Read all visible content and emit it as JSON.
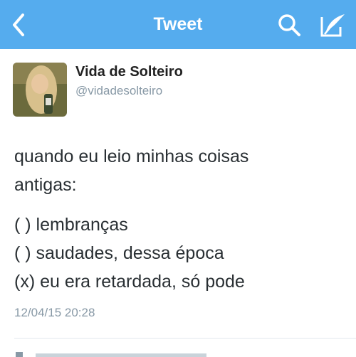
{
  "header": {
    "title": "Tweet",
    "bg_color": "#55acee",
    "back_icon": "chevron-left-icon",
    "search_icon": "search-icon",
    "compose_icon": "compose-icon"
  },
  "tweet": {
    "name": "Vida de Solteiro",
    "handle": "@vidadesolteiro",
    "text_lines": [
      "quando eu leio minhas coisas",
      "antigas:"
    ],
    "options": [
      "( ) lembranças",
      "( ) saudades, dessa época",
      "(x) eu era retardada, só pode"
    ],
    "timestamp": "12/04/15 20:28"
  }
}
